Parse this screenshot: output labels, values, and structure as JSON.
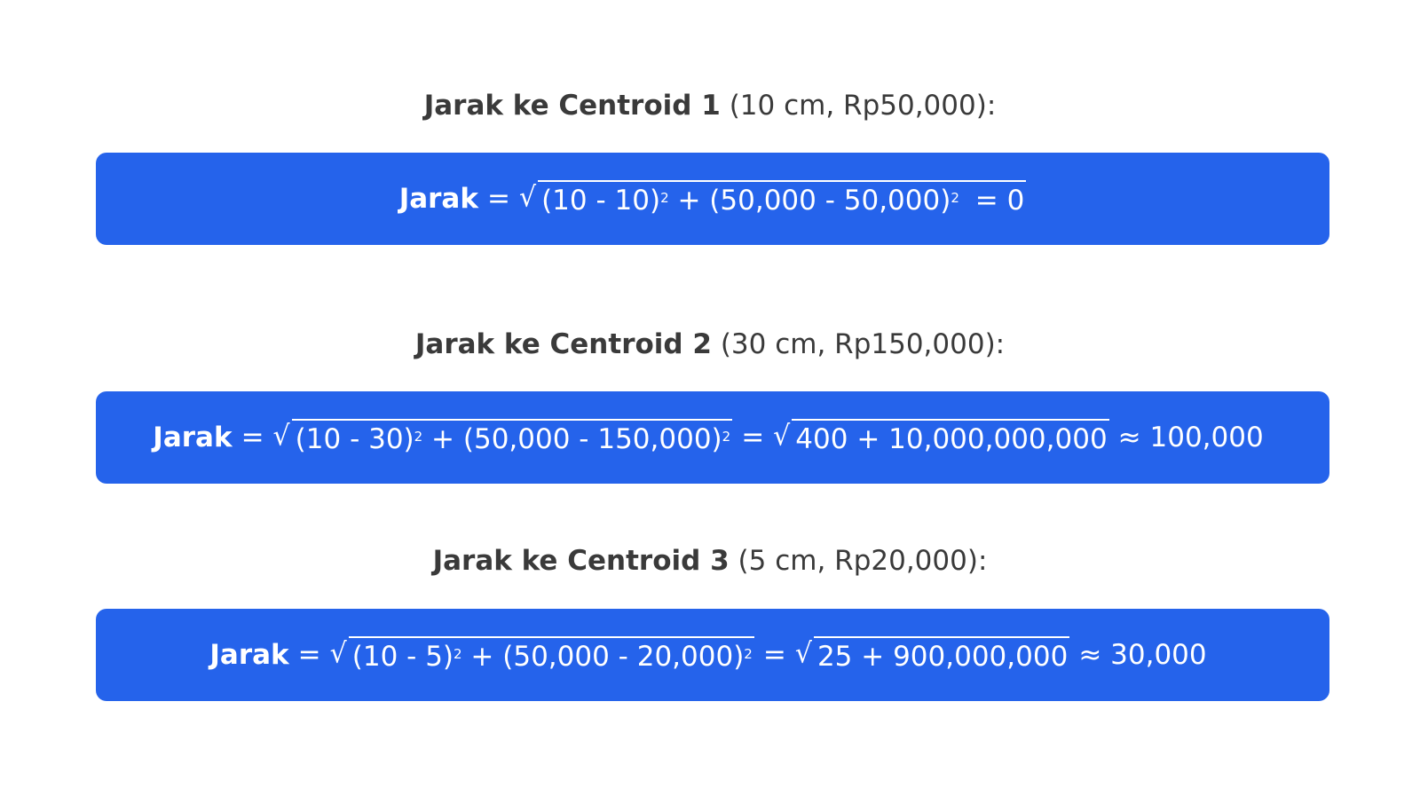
{
  "colors": {
    "band_background": "#2563eb",
    "heading_text": "#3a3a3a",
    "formula_text": "#ffffff"
  },
  "sections": [
    {
      "heading_bold": "Jarak ke Centroid 1",
      "heading_rest": "(10 cm, Rp50,000):",
      "lhs": "Jarak",
      "eq": "=",
      "sqrt1": {
        "a": "(10 - 10)",
        "exp_a": "2",
        "plus": " + ",
        "b": "(50,000 - 50,000)",
        "exp_b": "2"
      },
      "tail": "= 0"
    },
    {
      "heading_bold": "Jarak ke Centroid 2",
      "heading_rest": "(30 cm, Rp150,000):",
      "lhs": "Jarak",
      "eq": "=",
      "sqrt1": {
        "a": "(10 - 30)",
        "exp_a": "2",
        "plus": " + ",
        "b": "(50,000 - 150,000)",
        "exp_b": "2"
      },
      "eq2": "=",
      "sqrt2": "400 + 10,000,000,000",
      "approx": "≈ 100,000"
    },
    {
      "heading_bold": "Jarak ke Centroid 3",
      "heading_rest": "(5 cm, Rp20,000):",
      "lhs": "Jarak",
      "eq": "=",
      "sqrt1": {
        "a": "(10 - 5)",
        "exp_a": "2",
        "plus": " + ",
        "b": "(50,000 - 20,000)",
        "exp_b": "2"
      },
      "eq2": "=",
      "sqrt2": "25 + 900,000,000",
      "approx": "≈ 30,000"
    }
  ]
}
